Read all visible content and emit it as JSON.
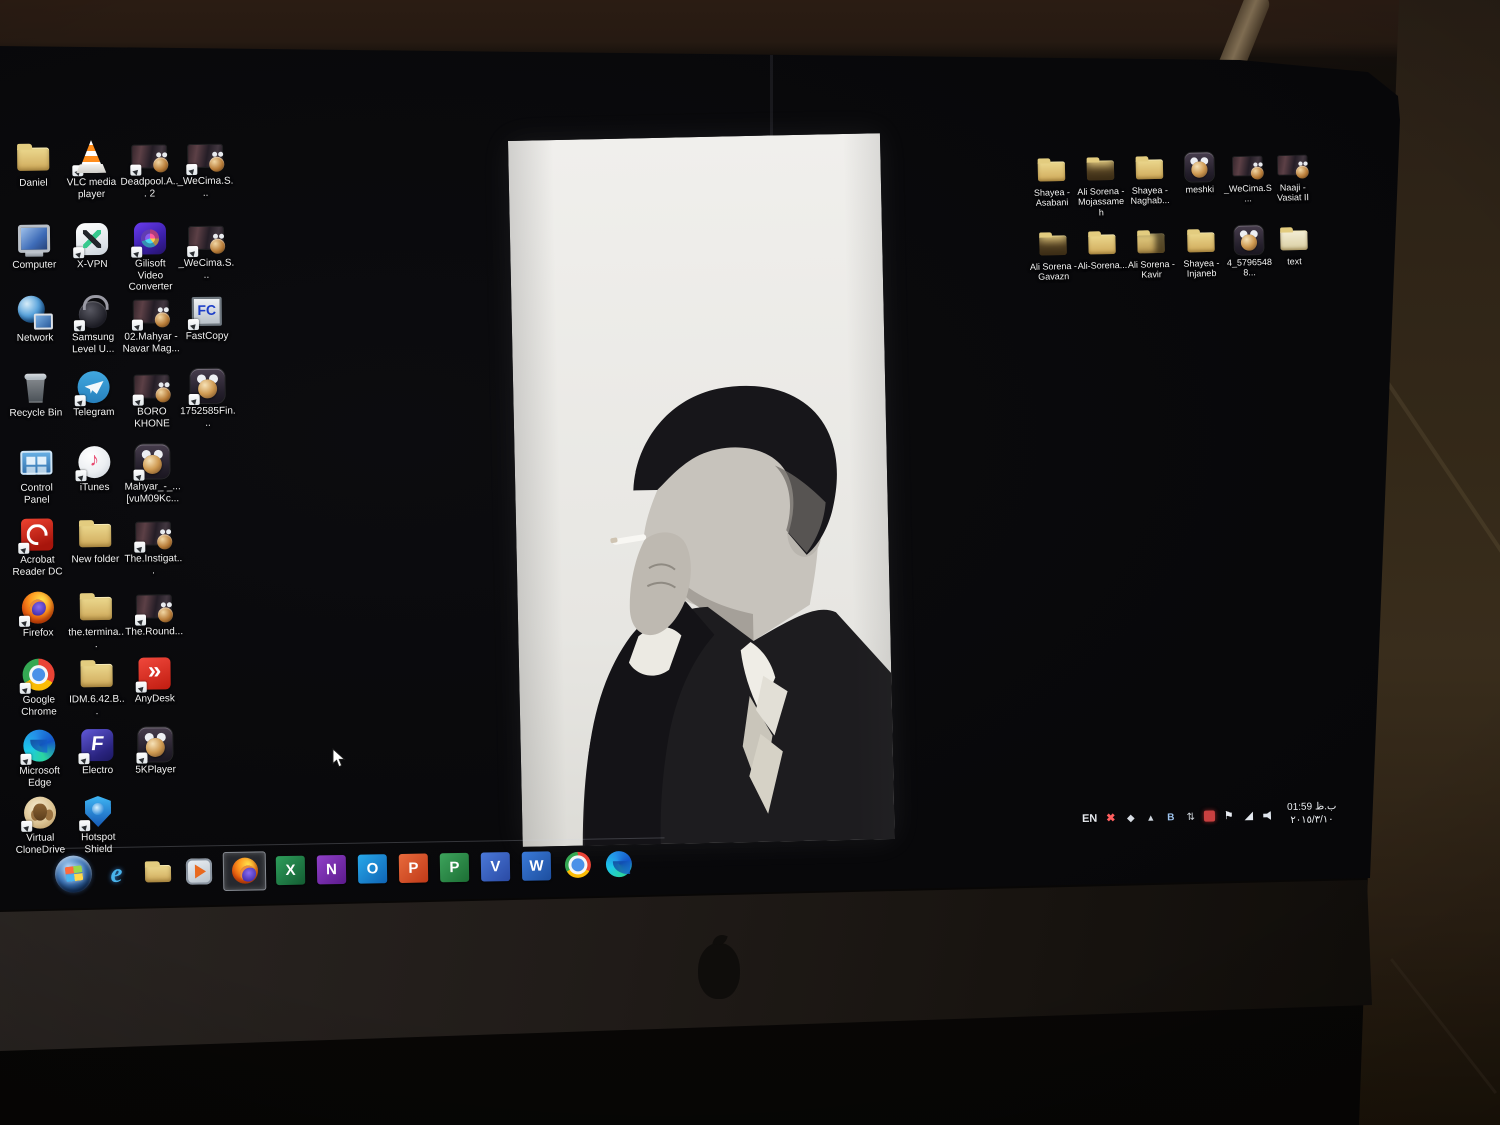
{
  "desktop": {
    "left_icons": [
      {
        "label": "Daniel",
        "kind": "folder-icon"
      },
      {
        "label": "VLC media player",
        "kind": "vlc-icon"
      },
      {
        "label": "Deadpool.A... 2",
        "kind": "video-file-icon"
      },
      {
        "label": "_WeCima.S...",
        "kind": "video-file-icon"
      },
      {
        "label": "Computer",
        "kind": "computer-icon"
      },
      {
        "label": "X-VPN",
        "kind": "x-vpn-icon"
      },
      {
        "label": "Gilisoft Video Converter",
        "kind": "gilisoft-icon"
      },
      {
        "label": "_WeCima.S...",
        "kind": "video-file-icon"
      },
      {
        "label": "Network",
        "kind": "network-icon"
      },
      {
        "label": "Samsung Level U...",
        "kind": "headset-icon"
      },
      {
        "label": "02.Mahyar - Navar Mag...",
        "kind": "video-file-icon"
      },
      {
        "label": "FastCopy",
        "kind": "fastcopy-icon",
        "glyph": "FC"
      },
      {
        "label": "Recycle Bin",
        "kind": "recycle-bin-icon"
      },
      {
        "label": "Telegram",
        "kind": "telegram-icon"
      },
      {
        "label": "BORO KHONE",
        "kind": "video-file-icon"
      },
      {
        "label": "1752585Fin...",
        "kind": "kmplayer-icon"
      },
      {
        "label": "Control Panel",
        "kind": "control-panel-icon"
      },
      {
        "label": "iTunes",
        "kind": "itunes-icon"
      },
      {
        "label": "Mahyar_-_... [vuM09Kc...",
        "kind": "kmplayer-icon"
      },
      {
        "label": "Acrobat Reader DC",
        "kind": "acrobat-icon"
      },
      {
        "label": "New folder",
        "kind": "folder-icon"
      },
      {
        "label": "The.Instigat...",
        "kind": "video-file-icon"
      },
      {
        "label": "Firefox",
        "kind": "firefox-icon"
      },
      {
        "label": "the.termina...",
        "kind": "folder-icon"
      },
      {
        "label": "The.Round...",
        "kind": "video-file-icon"
      },
      {
        "label": "Google Chrome",
        "kind": "chrome-icon"
      },
      {
        "label": "IDM.6.42.B...",
        "kind": "folder-icon"
      },
      {
        "label": "AnyDesk",
        "kind": "anydesk-icon"
      },
      {
        "label": "Microsoft Edge",
        "kind": "edge-icon"
      },
      {
        "label": "Electro",
        "kind": "electro-icon"
      },
      {
        "label": "5KPlayer",
        "kind": "kmplayer-icon"
      },
      {
        "label": "Virtual CloneDrive",
        "kind": "clonedrive-icon"
      },
      {
        "label": "Hotspot Shield",
        "kind": "hotspot-shield-icon"
      }
    ],
    "right_icons": [
      {
        "label": "Shayea - Asabani",
        "kind": "folder-icon"
      },
      {
        "label": "Ali Sorena - Mojassameh",
        "kind": "folder-icon"
      },
      {
        "label": "Shayea - Naghab...",
        "kind": "folder-icon"
      },
      {
        "label": "meshki",
        "kind": "kmplayer-icon"
      },
      {
        "label": "_WeCima.S...",
        "kind": "video-file-icon"
      },
      {
        "label": "Naaji - Vasiat II",
        "kind": "video-file-icon"
      },
      {
        "label": "Ali Sorena - Gavazn",
        "kind": "folder-icon"
      },
      {
        "label": "Ali-Sorena...",
        "kind": "folder-icon"
      },
      {
        "label": "Ali Sorena - Kavir",
        "kind": "folder-icon"
      },
      {
        "label": "Shayea - Injaneb",
        "kind": "folder-icon"
      },
      {
        "label": "4_57965488...",
        "kind": "kmplayer-icon"
      },
      {
        "label": "text",
        "kind": "folder-icon"
      }
    ]
  },
  "taskbar": {
    "items": [
      {
        "name": "Start"
      },
      {
        "name": "Internet Explorer",
        "glyph": "e"
      },
      {
        "name": "File Explorer"
      },
      {
        "name": "Media Player"
      },
      {
        "name": "Firefox"
      },
      {
        "name": "Excel",
        "glyph": "X"
      },
      {
        "name": "OneNote",
        "glyph": "N"
      },
      {
        "name": "Outlook",
        "glyph": "O"
      },
      {
        "name": "PowerPoint",
        "glyph": "P"
      },
      {
        "name": "Project",
        "glyph": "P"
      },
      {
        "name": "Visio",
        "glyph": "V"
      },
      {
        "name": "Word",
        "glyph": "W"
      },
      {
        "name": "Chrome"
      },
      {
        "name": "Edge"
      }
    ],
    "tray": {
      "language": "EN",
      "icon_names": [
        "disconnected-icon",
        "diamond-tray-icon",
        "show-hidden-icons",
        "bluetooth-icon",
        "device-sync-icon",
        "recording-icon",
        "action-center-flag-icon",
        "network-signal-icon",
        "volume-icon"
      ],
      "time": "01:59 ب.ظ",
      "date": "٢٠١٥/٣/١٠"
    }
  }
}
